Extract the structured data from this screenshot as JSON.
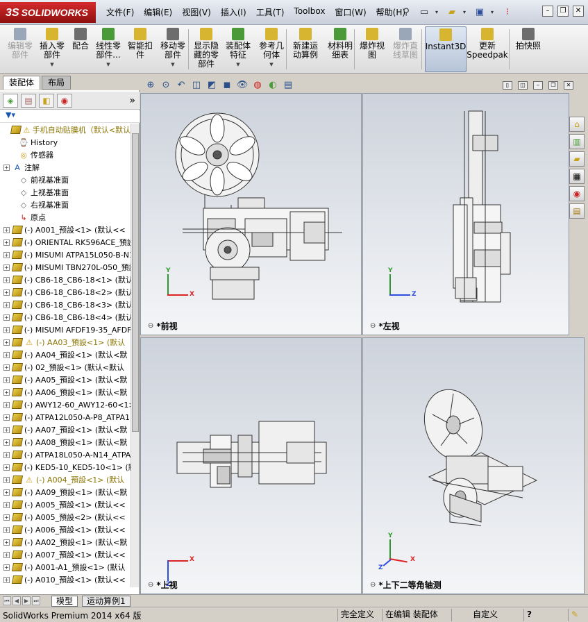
{
  "app": {
    "logo_text": "SOLIDWORKS",
    "logo_prefix": "3S"
  },
  "menu": [
    "文件(F)",
    "编辑(E)",
    "视图(V)",
    "插入(I)",
    "工具(T)",
    "Toolbox",
    "窗口(W)",
    "帮助(H)"
  ],
  "commands": [
    {
      "label": "编辑零\n部件",
      "disabled": true,
      "arrow": false,
      "color": "#9aa7b8"
    },
    {
      "label": "插入零\n部件",
      "disabled": false,
      "arrow": true,
      "color": "#d8b530"
    },
    {
      "label": "配合",
      "disabled": false,
      "arrow": false,
      "color": "#6d6d6d"
    },
    {
      "label": "线性零\n部件...",
      "disabled": false,
      "arrow": true,
      "color": "#4b9a3a"
    },
    {
      "label": "智能扣\n件",
      "disabled": false,
      "arrow": false,
      "color": "#d8b530"
    },
    {
      "label": "移动零\n部件",
      "disabled": false,
      "arrow": true,
      "color": "#6d6d6d"
    },
    {
      "label": "显示隐\n藏的零\n部件",
      "disabled": false,
      "arrow": false,
      "color": "#d8b530"
    },
    {
      "label": "装配体\n特征",
      "disabled": false,
      "arrow": true,
      "color": "#4b9a3a"
    },
    {
      "label": "参考几\n何体",
      "disabled": false,
      "arrow": true,
      "color": "#d8b530"
    },
    {
      "label": "新建运\n动算例",
      "disabled": false,
      "arrow": false,
      "color": "#d8b530"
    },
    {
      "label": "材料明\n细表",
      "disabled": false,
      "arrow": false,
      "color": "#4b9a3a"
    },
    {
      "label": "爆炸视\n图",
      "disabled": false,
      "arrow": false,
      "color": "#d8b530"
    },
    {
      "label": "爆炸直\n线草图",
      "disabled": true,
      "arrow": false,
      "color": "#9aa7b8"
    },
    {
      "label": "Instant3D",
      "disabled": false,
      "arrow": false,
      "active": true,
      "color": "#d8b530"
    },
    {
      "label": "更新\nSpeedpak",
      "disabled": false,
      "arrow": false,
      "color": "#d8b530"
    },
    {
      "label": "拍快照",
      "disabled": false,
      "arrow": false,
      "color": "#6d6d6d"
    }
  ],
  "panel": {
    "tab_assembly": "装配体",
    "tab_layout": "布局",
    "collapse_glyph": "»"
  },
  "tree": {
    "root": "手机自动贴膜机（默认<默认",
    "fixed": [
      "History",
      "传感器",
      "注解",
      "前视基准面",
      "上视基准面",
      "右视基准面",
      "原点"
    ],
    "components": [
      {
        "text": "(-) A001_预設<1> (默认<<",
        "warn": false
      },
      {
        "text": "(-) ORIENTAL RK596ACE_預設",
        "warn": false
      },
      {
        "text": "(-) MISUMI ATPA15L050-B-N1",
        "warn": false
      },
      {
        "text": "(-) MISUMI TBN270L-050_預設",
        "warn": false
      },
      {
        "text": "(-) CB6-18_CB6-18<1> (默认",
        "warn": false
      },
      {
        "text": "(-) CB6-18_CB6-18<2> (默认",
        "warn": false
      },
      {
        "text": "(-) CB6-18_CB6-18<3> (默认",
        "warn": false
      },
      {
        "text": "(-) CB6-18_CB6-18<4> (默认",
        "warn": false
      },
      {
        "text": "(-) MISUMI AFDF19-35_AFDF",
        "warn": false
      },
      {
        "text": "(-) AA03_預設<1> (默认",
        "warn": true
      },
      {
        "text": "(-) AA04_預設<1> (默认<默",
        "warn": false
      },
      {
        "text": "(-) 02_預設<1> (默认<默认",
        "warn": false
      },
      {
        "text": "(-) AA05_預設<1> (默认<默",
        "warn": false
      },
      {
        "text": "(-) AA06_預設<1> (默认<默",
        "warn": false
      },
      {
        "text": "(-) AWY12-60_AWY12-60<1>",
        "warn": false
      },
      {
        "text": "(-) ATPA12L050-A-P8_ATPA1",
        "warn": false
      },
      {
        "text": "(-) AA07_預設<1> (默认<默",
        "warn": false
      },
      {
        "text": "(-) AA08_預設<1> (默认<默",
        "warn": false
      },
      {
        "text": "(-) ATPA18L050-A-N14_ATPA",
        "warn": false
      },
      {
        "text": "(-) KED5-10_KED5-10<1> (默",
        "warn": false
      },
      {
        "text": "(-) A004_預設<1> (默认",
        "warn": true
      },
      {
        "text": "(-) AA09_預設<1> (默认<默",
        "warn": false
      },
      {
        "text": "(-) A005_預設<1> (默认<<",
        "warn": false
      },
      {
        "text": "(-) A005_預設<2> (默认<<",
        "warn": false
      },
      {
        "text": "(-) A006_預設<1> (默认<<",
        "warn": false
      },
      {
        "text": "(-) AA02_預設<1> (默认<默",
        "warn": false
      },
      {
        "text": "(-) A007_預設<1> (默认<<",
        "warn": false
      },
      {
        "text": "(-) A001-A1_預設<1> (默认",
        "warn": false
      },
      {
        "text": "(-) A010_預設<1> (默认<<",
        "warn": false
      }
    ]
  },
  "viewports": {
    "front": "*前视",
    "left": "*左视",
    "top": "*上视",
    "iso": "*上下二等角轴测"
  },
  "axes": {
    "x": "X",
    "y": "Y",
    "z": "Z"
  },
  "bottom_tabs": [
    "模型",
    "运动算例1"
  ],
  "status": {
    "product": "SolidWorks Premium 2014 x64 版",
    "defined": "完全定义",
    "editing": "在编辑 装配体",
    "custom": "自定义",
    "help": "?"
  }
}
